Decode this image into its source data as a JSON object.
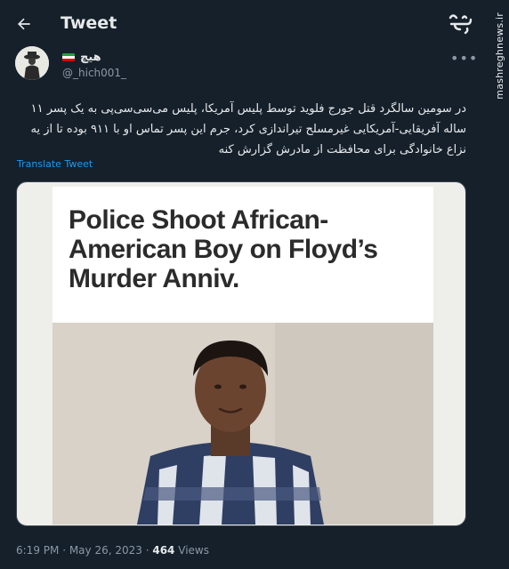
{
  "header": {
    "title": "Tweet",
    "back_icon": "arrow-left-icon"
  },
  "brand": {
    "logo_text": "مشرق",
    "url": "mashreghnews.ir"
  },
  "author": {
    "display_name": "هیچ",
    "handle": "@_hich001_",
    "flag": "iran-flag-icon",
    "flag_colors": [
      "#239f40",
      "#ffffff",
      "#da0000"
    ]
  },
  "tweet": {
    "text": "در سومین سالگرد قتل جورج فلوید توسط پلیس آمریکا، پلیس می‌سی‌سی‌پی به یک پسر ۱۱ ساله آفریقایی-آمریکایی غیرمسلح تیراندازی کرد، جرم این پسر تماس او با ۹۱۱ بوده تا از یه نزاع خانوادگی برای محافظت از مادرش گزارش کنه",
    "translate_label": "Translate Tweet",
    "more_icon": "more-horizontal-icon"
  },
  "media": {
    "headline": "Police Shoot African-American Boy on Floyd’s Murder Anniv."
  },
  "meta": {
    "time": "6:19 PM",
    "date": "May 26, 2023",
    "views_count": "464",
    "views_label": "Views"
  },
  "colors": {
    "background": "#15202b",
    "text": "#e7e9ea",
    "secondary": "#8b98a5",
    "accent": "#1d9bf0"
  }
}
